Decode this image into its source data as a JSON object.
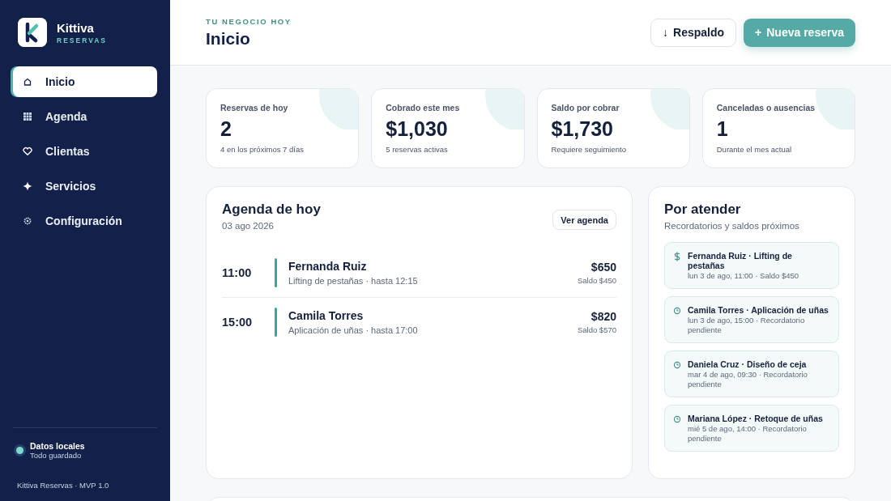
{
  "brand": {
    "name": "Kittiva",
    "subtitle": "RESERVAS"
  },
  "nav": [
    {
      "kind": "home",
      "label": "Inicio",
      "selected": true
    },
    {
      "kind": "grid",
      "label": "Agenda",
      "selected": false
    },
    {
      "kind": "heart",
      "label": "Clientas",
      "selected": false
    },
    {
      "kind": "sparkle",
      "label": "Servicios",
      "selected": false
    },
    {
      "kind": "gear",
      "label": "Configuración",
      "selected": false
    }
  ],
  "sync": {
    "title": "Datos locales",
    "subtitle": "Todo guardado",
    "color": "#7fd8d0"
  },
  "version": "Kittiva Reservas · MVP 1.0",
  "header": {
    "eyebrow": "TU NEGOCIO HOY",
    "title": "Inicio",
    "buttons": [
      {
        "kind": "secondary",
        "icon": "↓",
        "label": "Respaldo"
      },
      {
        "kind": "primary",
        "icon": "+",
        "label": "Nueva reserva"
      }
    ]
  },
  "stats": [
    {
      "label": "Reservas de hoy",
      "value": "2",
      "note": "4 en los próximos 7 días"
    },
    {
      "label": "Cobrado este mes",
      "value": "$1,030",
      "note": "5 reservas activas"
    },
    {
      "label": "Saldo por cobrar",
      "value": "$1,730",
      "note": "Requiere seguimiento"
    },
    {
      "label": "Canceladas o ausencias",
      "value": "1",
      "note": "Durante el mes actual"
    }
  ],
  "agenda": {
    "title": "Agenda de hoy",
    "date": "03 ago 2026",
    "button": "Ver agenda",
    "items": [
      {
        "time": "11:00",
        "client": "Fernanda Ruiz",
        "detail": "Lifting de pestañas · hasta 12:15",
        "price": "$650",
        "balance": "Saldo $450"
      },
      {
        "time": "15:00",
        "client": "Camila Torres",
        "detail": "Aplicación de uñas · hasta 17:00",
        "price": "$820",
        "balance": "Saldo $570"
      }
    ]
  },
  "pending": {
    "title": "Por atender",
    "subtitle": "Recordatorios y saldos próximos",
    "items": [
      {
        "kind": "balance",
        "title": "Fernanda Ruiz · Lifting de pestañas",
        "detail": "lun 3 de ago, 11:00 · Saldo $450"
      },
      {
        "kind": "reminder",
        "title": "Camila Torres · Aplicación de uñas",
        "detail": "lun 3 de ago, 15:00 · Recordatorio pendiente"
      },
      {
        "kind": "reminder",
        "title": "Daniela Cruz · Diseño de ceja",
        "detail": "mar 4 de ago, 09:30 · Recordatorio pendiente"
      },
      {
        "kind": "reminder",
        "title": "Mariana López · Retoque de uñas",
        "detail": "mié 5 de ago, 14:00 · Recordatorio pendiente"
      }
    ]
  }
}
